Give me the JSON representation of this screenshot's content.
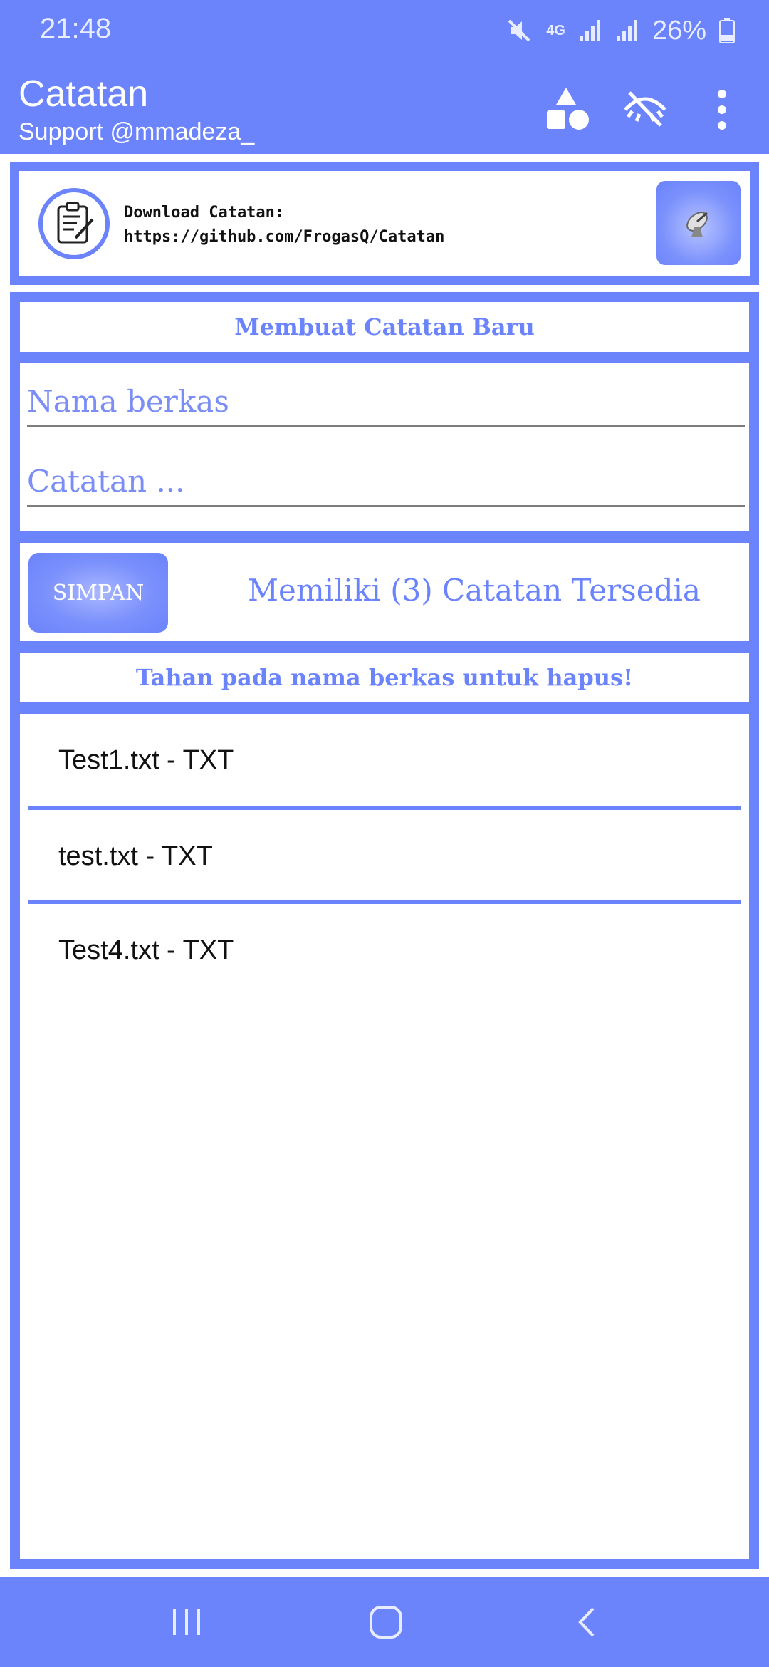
{
  "status_bar": {
    "time": "21:48",
    "network": "4G",
    "battery": "26%"
  },
  "app_bar": {
    "title": "Catatan",
    "subtitle": "Support @mmadeza_"
  },
  "promo": {
    "line1": "Download Catatan:",
    "line2": "https://github.com/FrogasQ/Catatan",
    "button_icon": "satellite-dish-icon"
  },
  "form": {
    "header": "Membuat Catatan Baru",
    "name_placeholder": "Nama berkas",
    "name_value": "",
    "note_placeholder": "Catatan ...",
    "note_value": "",
    "save_label": "SIMPAN",
    "count_text": "Memiliki (3) Catatan Tersedia",
    "hint": "Tahan pada nama berkas untuk hapus!"
  },
  "notes": [
    {
      "label": "Test1.txt - TXT"
    },
    {
      "label": "test.txt - TXT"
    },
    {
      "label": "Test4.txt - TXT"
    }
  ],
  "colors": {
    "accent": "#6b83fb",
    "background": "#ffffff",
    "text": "#111111"
  }
}
